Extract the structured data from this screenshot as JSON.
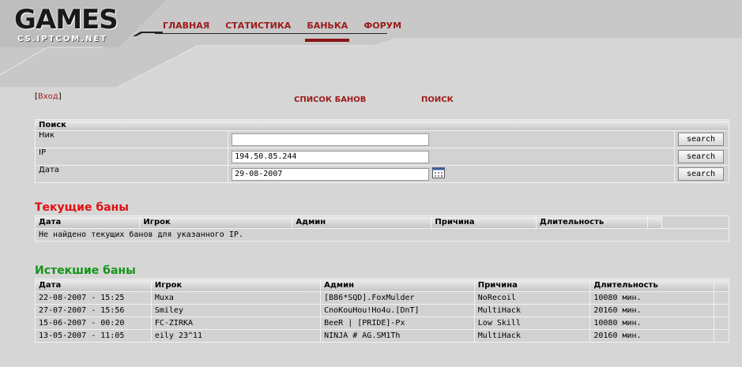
{
  "logo": {
    "title": "GAMES",
    "subtitle": "CS.IPTCOM.NET"
  },
  "nav": [
    {
      "label": "ГЛАВНАЯ",
      "active": false
    },
    {
      "label": "СТАТИСТИКА",
      "active": false
    },
    {
      "label": "БАНЬКА",
      "active": true
    },
    {
      "label": "ФОРУМ",
      "active": false
    }
  ],
  "login": {
    "label": "Вход"
  },
  "links": {
    "ban_list": "СПИСОК БАНОВ",
    "search": "ПОИСК"
  },
  "search_form": {
    "caption": "Поиск",
    "fields": [
      {
        "label": "Ник",
        "value": "",
        "button": "search"
      },
      {
        "label": "IP",
        "value": "194.50.85.244",
        "button": "search"
      },
      {
        "label": "Дата",
        "value": "29-08-2007",
        "button": "search"
      }
    ]
  },
  "current_bans": {
    "title": "Текущие баны",
    "columns": [
      "Дата",
      "Игрок",
      "Админ",
      "Причина",
      "Длительность"
    ],
    "empty_message": "Не найдено текущих банов для указанного IP."
  },
  "expired_bans": {
    "title": "Истекшие баны",
    "columns": [
      "Дата",
      "Игрок",
      "Админ",
      "Причина",
      "Длительность"
    ],
    "rows": [
      [
        "22-08-2007 - 15:25",
        "Muxa",
        "[B86*SQD].FoxMulder",
        "NoRecoil",
        "10080 мин."
      ],
      [
        "27-07-2007 - 15:56",
        "Smiley",
        "CnoKouHou!Ho4u.[DnT]",
        "MultiHack",
        "20160 мин."
      ],
      [
        "15-06-2007 - 00:20",
        "FC-ZIRKA",
        "BeeR | [PRIDE]-Px",
        "Low Skill",
        "10080 мин."
      ],
      [
        "13-05-2007 - 11:05",
        "eily 23^11",
        "NINJA # AG.SM1Th",
        "MultiHack",
        "20160 мин."
      ]
    ]
  },
  "colors": {
    "nav_red": "#9b1b1b",
    "current_title": "#e01010",
    "expired_title": "#14941a"
  }
}
